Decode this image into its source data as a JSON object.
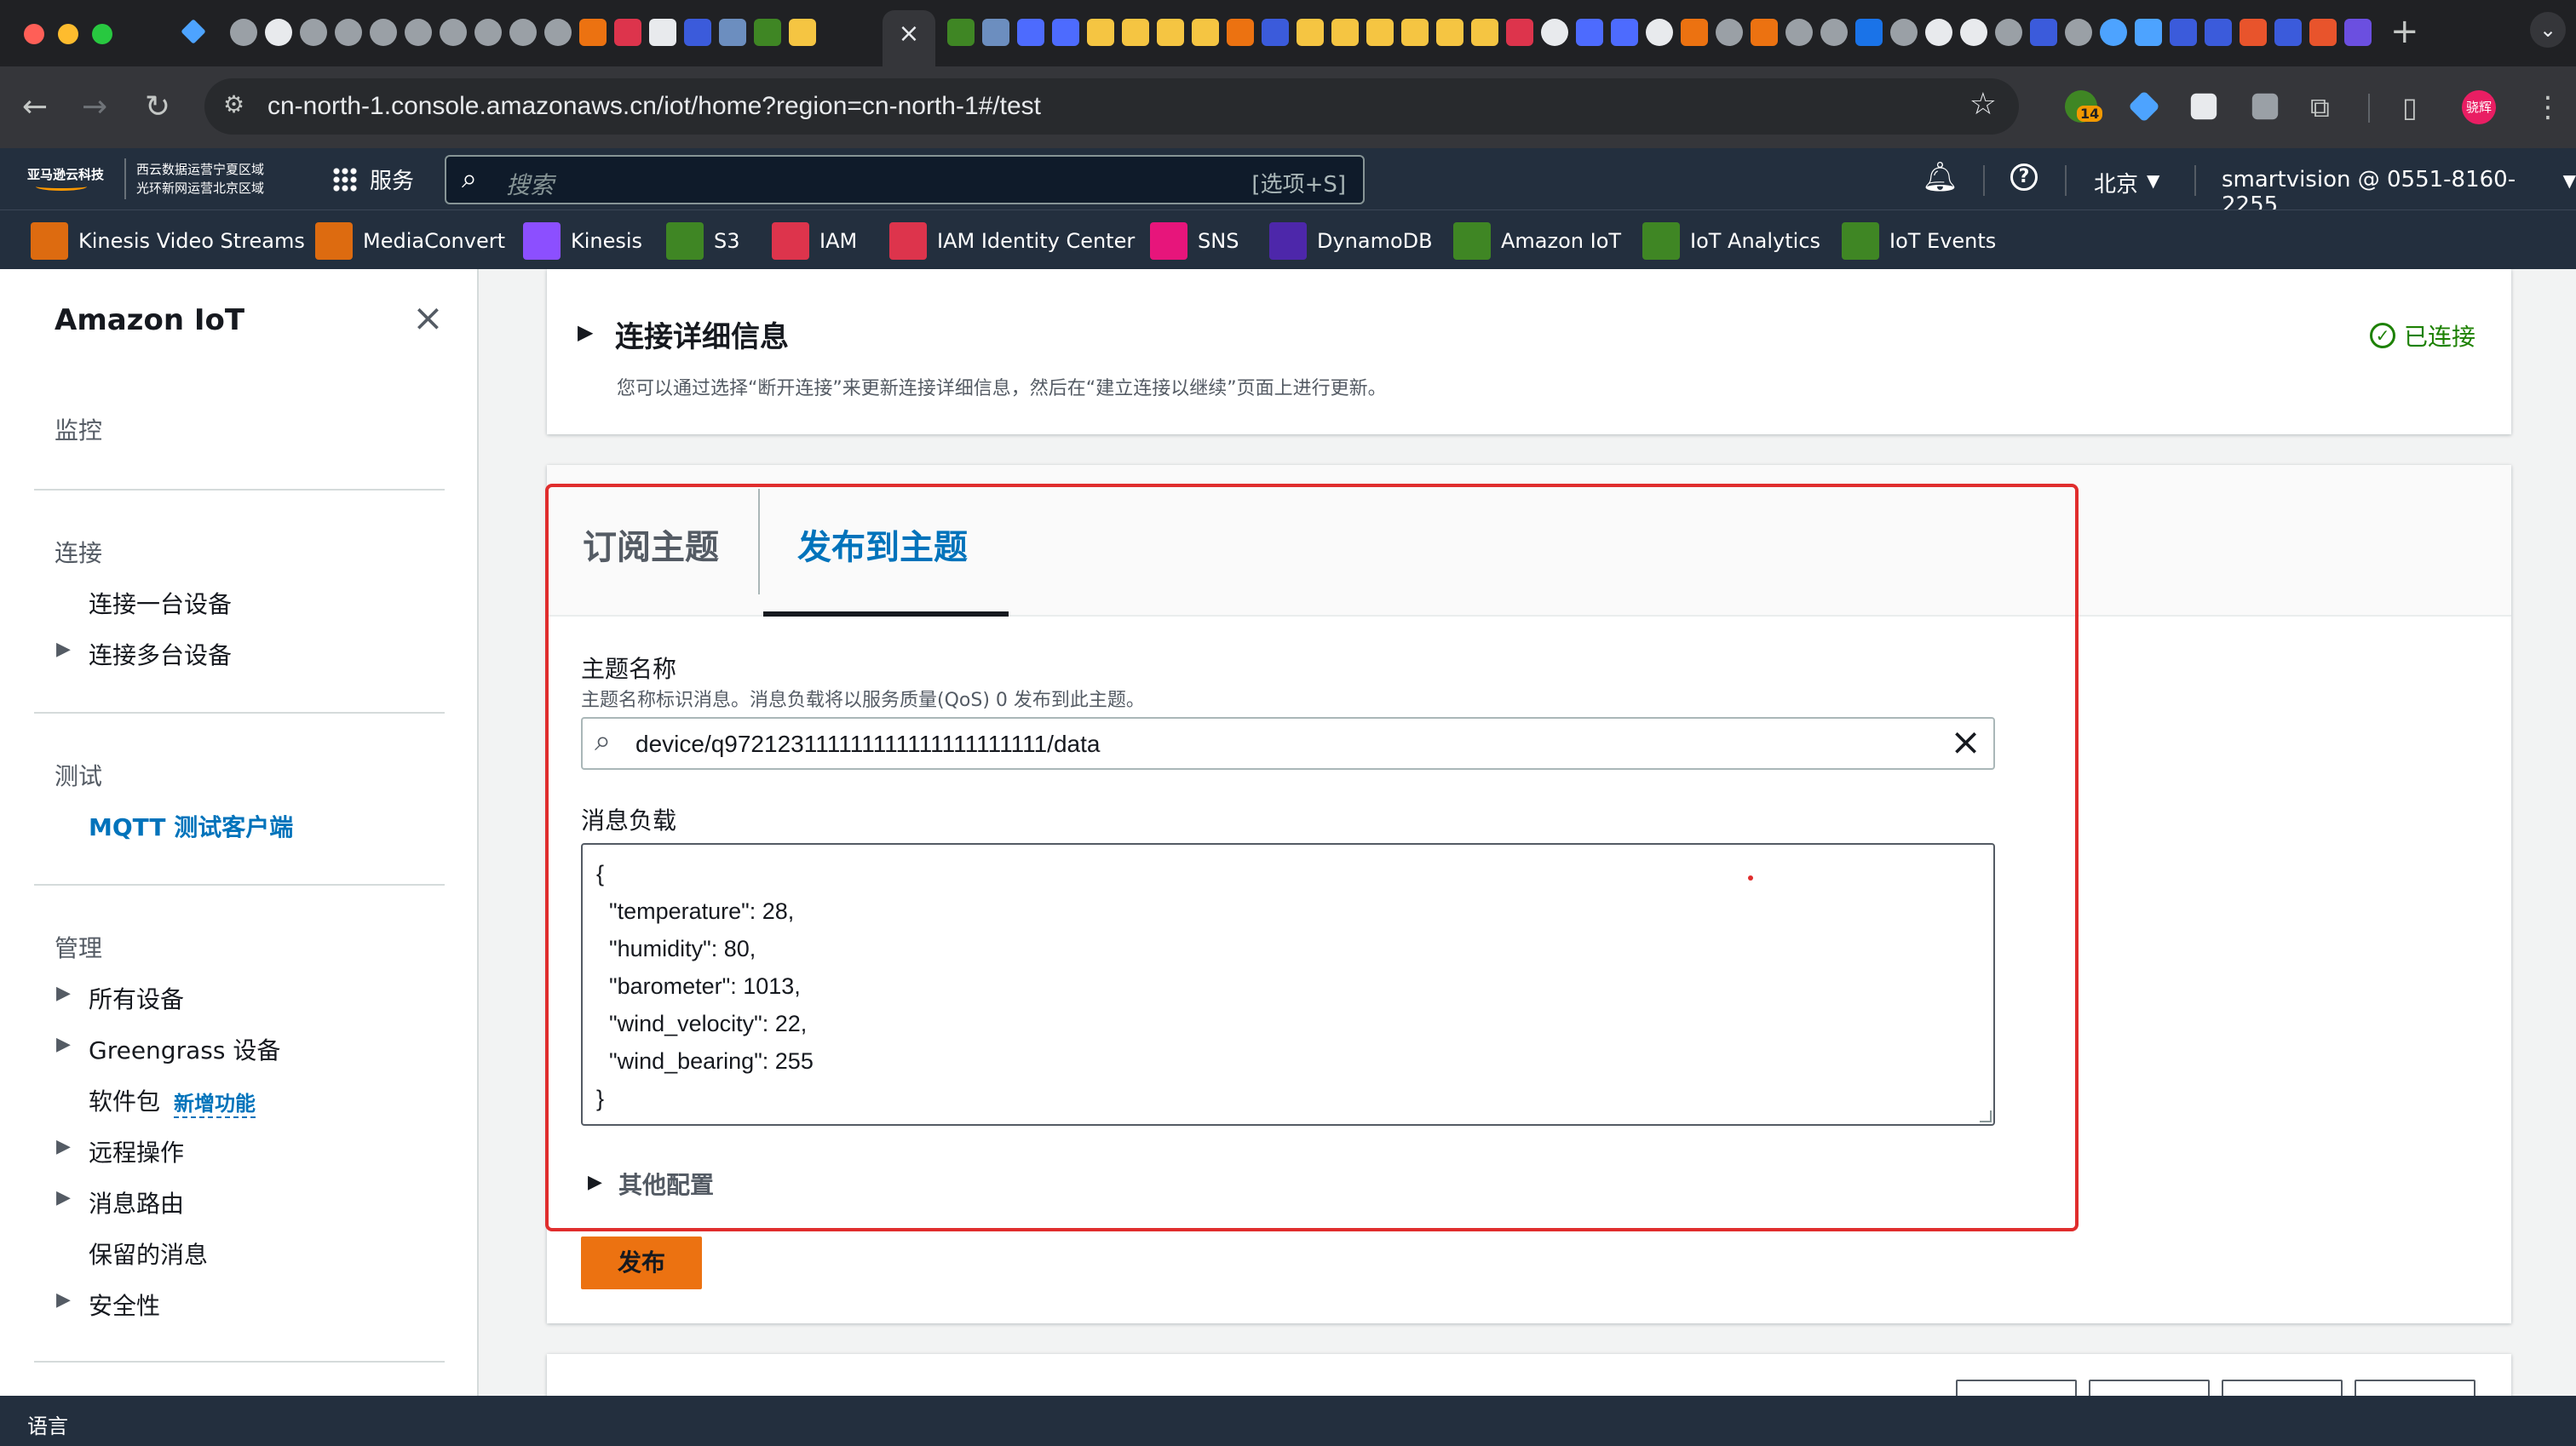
{
  "browser": {
    "active_tab_close": "×",
    "new_tab": "+",
    "url": "cn-north-1.console.amazonaws.cn/iot/home?region=cn-north-1#/test",
    "ext_badge": "14",
    "profile_initials": "骁辉"
  },
  "aws_nav": {
    "logo_line1": "亚马逊云科技",
    "org_line1": "西云数据运营宁夏区域",
    "org_line2": "光环新网运营北京区域",
    "services_label": "服务",
    "search_placeholder": "搜索",
    "search_shortcut": "[选项+S]",
    "region": "北京",
    "account": "smartvision @ 0551-8160-2255"
  },
  "favorites": [
    {
      "label": "Kinesis Video Streams",
      "color": "#dd6b10"
    },
    {
      "label": "MediaConvert",
      "color": "#dd6b10"
    },
    {
      "label": "Kinesis",
      "color": "#8c4fff"
    },
    {
      "label": "S3",
      "color": "#3f8624"
    },
    {
      "label": "IAM",
      "color": "#dd344c"
    },
    {
      "label": "IAM Identity Center",
      "color": "#dd344c"
    },
    {
      "label": "SNS",
      "color": "#e7157b"
    },
    {
      "label": "DynamoDB",
      "color": "#4d27aa"
    },
    {
      "label": "Amazon IoT",
      "color": "#3f8624"
    },
    {
      "label": "IoT Analytics",
      "color": "#3f8624"
    },
    {
      "label": "IoT Events",
      "color": "#3f8624"
    }
  ],
  "sidebar": {
    "title": "Amazon IoT",
    "monitor": "监控",
    "connect": "连接",
    "connect_one": "连接一台设备",
    "connect_many": "连接多台设备",
    "test": "测试",
    "mqtt_client": "MQTT 测试客户端",
    "manage": "管理",
    "all_devices": "所有设备",
    "greengrass": "Greengrass 设备",
    "software": "软件包",
    "new_feature": "新增功能",
    "remote_ops": "远程操作",
    "message_routing": "消息路由",
    "retained_messages": "保留的消息",
    "security": "安全性"
  },
  "connection": {
    "title": "连接详细信息",
    "description": "您可以通过选择“断开连接”来更新连接详细信息，然后在“建立连接以继续”页面上进行更新。",
    "status": "已连接",
    "status_color": "#1d8102"
  },
  "tabs": {
    "subscribe": "订阅主题",
    "publish": "发布到主题"
  },
  "publish": {
    "topic_label": "主题名称",
    "topic_hint": "主题名称标识消息。消息负载将以服务质量(QoS) 0 发布到此主题。",
    "topic_value": "device/q972123111111111111111111111/data",
    "payload_label": "消息负载",
    "payload_lines": [
      "{",
      "  \"temperature\": 28,",
      "  \"humidity\": 80,",
      "  \"barometer\": 1013,",
      "  \"wind_velocity\": 22,",
      "  \"wind_bearing\": 255",
      "}"
    ],
    "other_config": "其他配置",
    "publish_button": "发布"
  },
  "footer": {
    "language": "语言"
  },
  "colors": {
    "aws_orange": "#ec7211",
    "link_blue": "#0073bb",
    "highlight_red": "#e02d2d"
  }
}
